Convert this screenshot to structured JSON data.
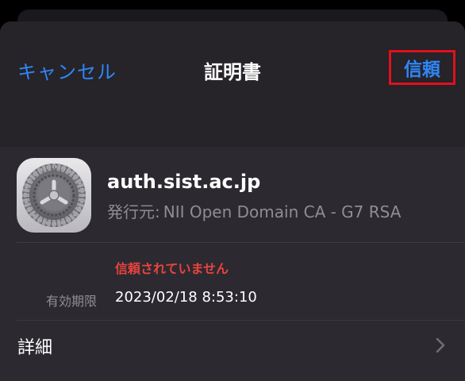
{
  "nav": {
    "cancel_label": "キャンセル",
    "title": "証明書",
    "trust_label": "信頼"
  },
  "certificate": {
    "icon": "settings-gear-icon",
    "name": "auth.sist.ac.jp",
    "issuer_label": "発行元:",
    "issuer_value": "NII Open Domain CA - G7 RSA",
    "status": "信頼されていません",
    "expires_label": "有効期限",
    "expires_value": "2023/02/18 8:53:10"
  },
  "details": {
    "label": "詳細",
    "icon": "chevron-right-icon"
  },
  "colors": {
    "accent": "#2f86f6",
    "warning": "#e8433f",
    "highlight_box": "#e0101a"
  }
}
